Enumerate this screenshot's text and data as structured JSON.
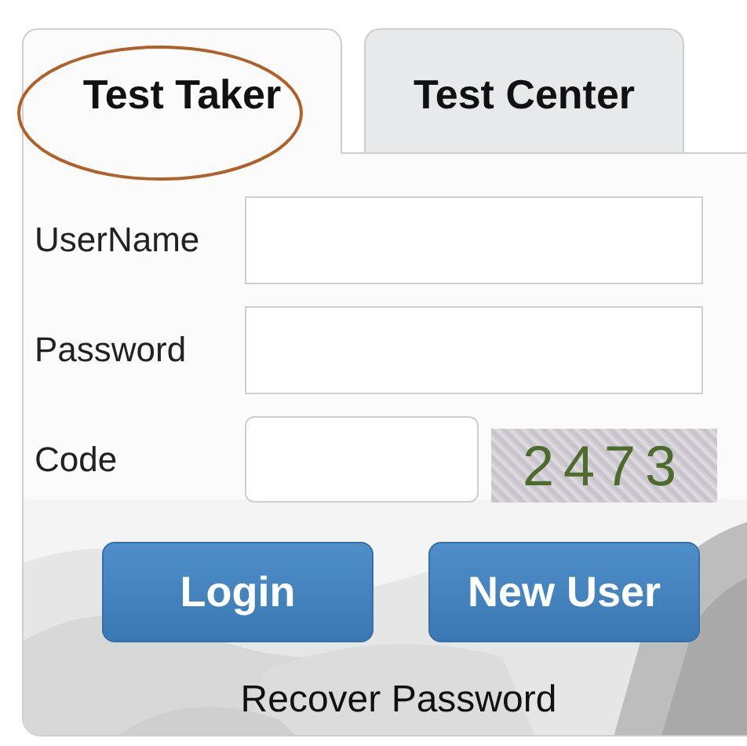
{
  "tabs": [
    {
      "label": "Test Taker",
      "selected": true,
      "highlighted": true
    },
    {
      "label": "Test Center",
      "selected": false,
      "highlighted": false
    }
  ],
  "fields": [
    {
      "label": "UserName",
      "kind": "text"
    },
    {
      "label": "Password",
      "kind": "password"
    },
    {
      "label": "Code",
      "kind": "captcha",
      "captcha": "2473"
    }
  ],
  "buttons": [
    "Login",
    "New User"
  ],
  "link": "Recover Password"
}
